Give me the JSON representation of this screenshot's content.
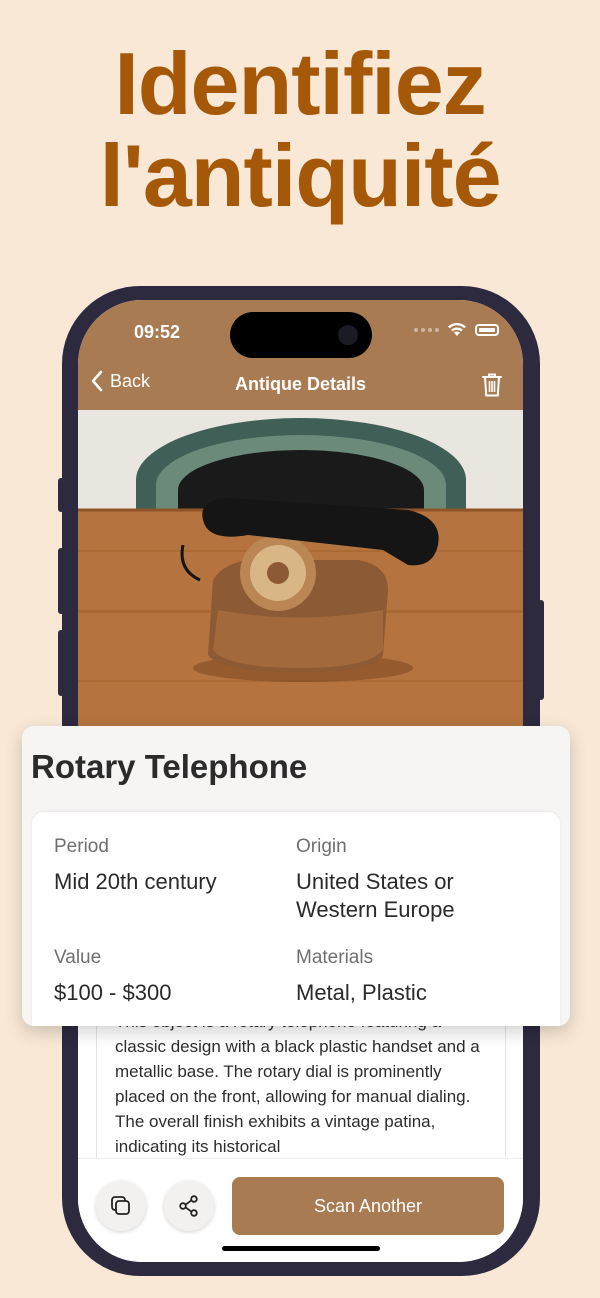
{
  "headline": {
    "line1": "Identifiez",
    "line2": "l'antiquité"
  },
  "status_bar": {
    "time": "09:52"
  },
  "nav": {
    "back_label": "Back",
    "title": "Antique Details"
  },
  "card": {
    "title": "Rotary Telephone",
    "fields": [
      {
        "label": "Period",
        "value": "Mid 20th century"
      },
      {
        "label": "Origin",
        "value": "United States or Western Europe"
      },
      {
        "label": "Value",
        "value": "$100 - $300"
      },
      {
        "label": "Materials",
        "value": "Metal, Plastic"
      }
    ]
  },
  "description": "This object is a rotary telephone featuring a classic design with a black plastic handset and a metallic base. The rotary dial is prominently placed on the front, allowing for manual dialing. The overall finish exhibits a vintage patina, indicating its historical",
  "actions": {
    "scan_label": "Scan Another"
  },
  "colors": {
    "accent": "#a97b52",
    "headline": "#a55808",
    "background": "#f8e8d5",
    "phone_frame": "#2d2a40"
  }
}
